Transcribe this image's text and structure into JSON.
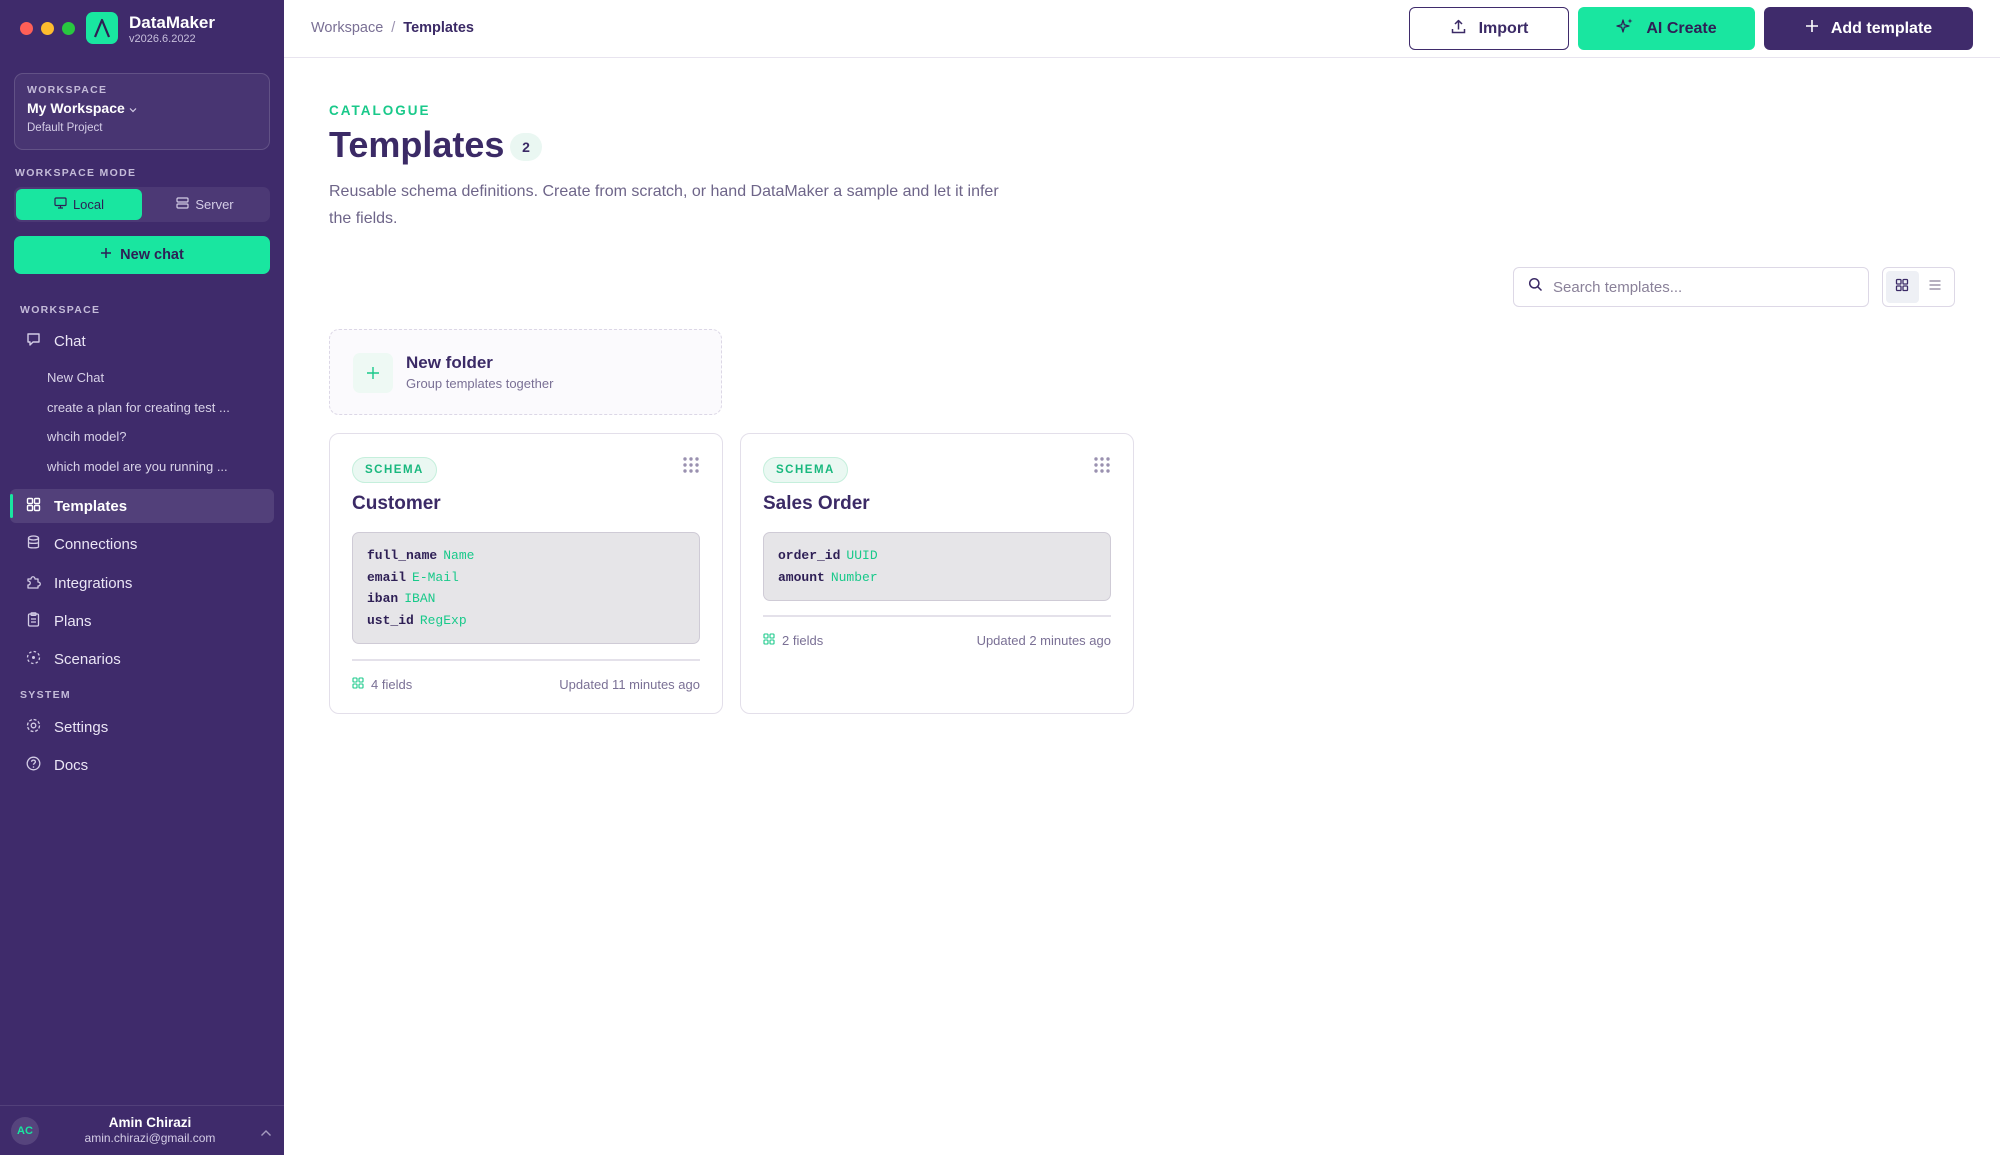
{
  "app": {
    "name": "DataMaker",
    "version": "v2026.6.2022"
  },
  "window_controls": {
    "close_color": "#ff5f57",
    "minimize_color": "#febc2e",
    "zoom_color": "#28c840"
  },
  "colors": {
    "sidebar": "#3f2b6b",
    "accent": "#19e6a0",
    "text_primary": "#3b2a66"
  },
  "workspace": {
    "caption": "WORKSPACE",
    "name": "My Workspace",
    "project": "Default Project"
  },
  "mode": {
    "caption": "WORKSPACE MODE",
    "local": "Local",
    "server": "Server",
    "selected": "Local"
  },
  "new_chat": "New chat",
  "nav": {
    "workspace_caption": "WORKSPACE",
    "chat": "Chat",
    "chat_history": [
      "New Chat",
      "create a plan for creating test ...",
      "whcih model?",
      "which model are you running ..."
    ],
    "templates": "Templates",
    "connections": "Connections",
    "integrations": "Integrations",
    "plans": "Plans",
    "scenarios": "Scenarios",
    "system_caption": "SYSTEM",
    "settings": "Settings",
    "docs": "Docs",
    "active": "Templates"
  },
  "user": {
    "initials": "AC",
    "name": "Amin Chirazi",
    "email": "amin.chirazi@gmail.com"
  },
  "breadcrumb": {
    "parent": "Workspace",
    "separator": "/",
    "current": "Templates"
  },
  "toolbar": {
    "import": "Import",
    "ai_create": "AI Create",
    "add_template": "Add template"
  },
  "page": {
    "eyebrow": "CATALOGUE",
    "title": "Templates",
    "count": "2",
    "description": "Reusable schema definitions. Create from scratch, or hand DataMaker a sample and let it infer the fields."
  },
  "search": {
    "placeholder": "Search templates...",
    "value": ""
  },
  "view": {
    "selected": "grid"
  },
  "new_folder": {
    "title": "New folder",
    "subtitle": "Group templates together"
  },
  "templates": [
    {
      "badge": "SCHEMA",
      "name": "Customer",
      "fields": [
        {
          "name": "full_name",
          "type": "Name"
        },
        {
          "name": "email",
          "type": "E-Mail"
        },
        {
          "name": "iban",
          "type": "IBAN"
        },
        {
          "name": "ust_id",
          "type": "RegExp"
        }
      ],
      "field_count": "4 fields",
      "updated": "Updated 11 minutes ago"
    },
    {
      "badge": "SCHEMA",
      "name": "Sales Order",
      "fields": [
        {
          "name": "order_id",
          "type": "UUID"
        },
        {
          "name": "amount",
          "type": "Number"
        }
      ],
      "field_count": "2 fields",
      "updated": "Updated 2 minutes ago"
    }
  ]
}
